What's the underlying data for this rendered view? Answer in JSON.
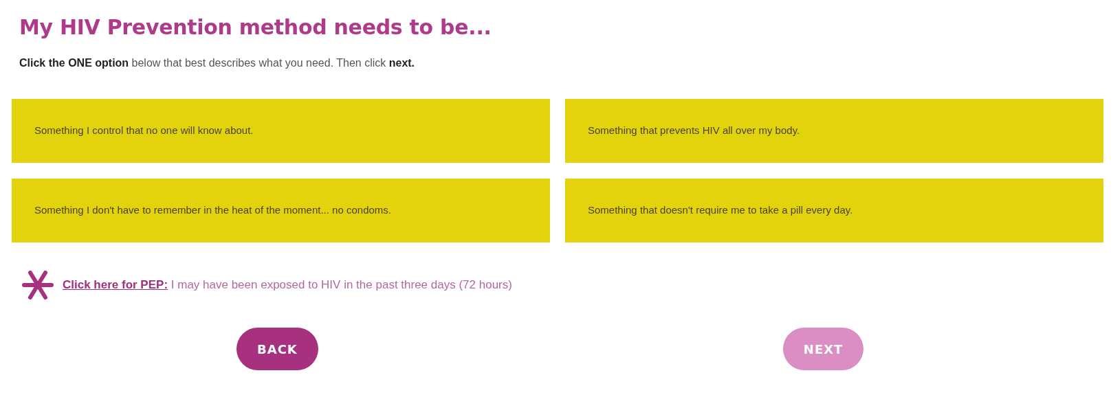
{
  "title": "My HIV Prevention method needs to be...",
  "instruction": "**Click the ONE option** below that best describes what you need. Then click **next.**",
  "options": [
    {
      "label": "Something I control that no one will know about.",
      "selected": false
    },
    {
      "label": "Something that prevents HIV all over my body.",
      "selected": false
    },
    {
      "label": "Something I don't have to remember in the heat of the moment... no condoms.",
      "selected": false
    },
    {
      "label": "Something that doesn't require me to take a pill every day.",
      "selected": false
    }
  ],
  "pep": {
    "link": "Click here for PEP:",
    "text": "I may have been exposed to HIV in the past three days (72 hours)"
  },
  "buttons": [
    {
      "label": "BACK",
      "disabled": false
    },
    {
      "label": "NEXT",
      "disabled": true
    }
  ]
}
